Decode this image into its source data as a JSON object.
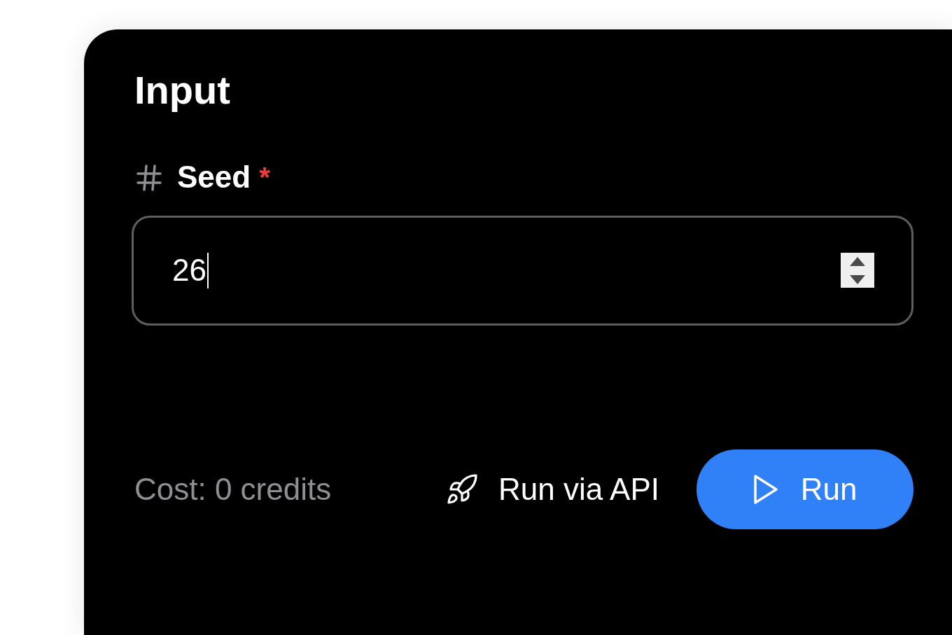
{
  "panel": {
    "title": "Input"
  },
  "field": {
    "label": "Seed",
    "required": true,
    "required_mark": "*",
    "value": "26",
    "focused": true
  },
  "footer": {
    "cost": "Cost: 0 credits",
    "buttons": [
      {
        "label": "Run via API",
        "kind": "secondary"
      },
      {
        "label": "Run",
        "kind": "primary"
      }
    ]
  }
}
